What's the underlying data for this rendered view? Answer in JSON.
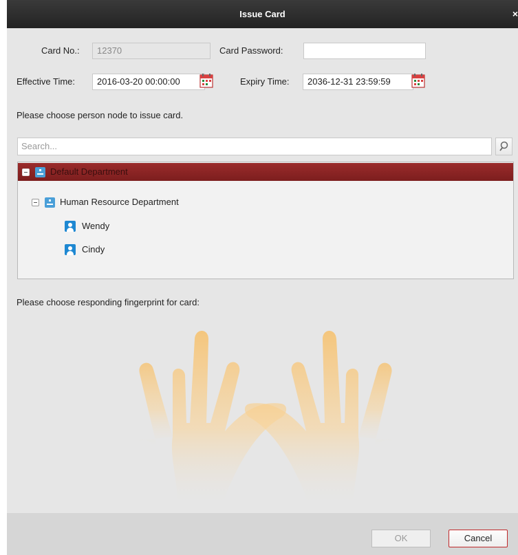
{
  "dialog": {
    "title": "Issue Card",
    "close_glyph": "×"
  },
  "card": {
    "card_no_label": "Card No.:",
    "card_no_value": "12370",
    "password_label": "Card Password:",
    "password_value": "",
    "effective_label": "Effective Time:",
    "effective_value": "2016-03-20 00:00:00",
    "expiry_label": "Expiry Time:",
    "expiry_value": "2036-12-31 23:59:59"
  },
  "instructions": {
    "person_prompt": "Please choose person node to issue card.",
    "fingerprint_prompt": "Please choose responding fingerprint for card:"
  },
  "search": {
    "placeholder": "Search..."
  },
  "tree": {
    "root": {
      "label": "Default Department",
      "selected": true
    },
    "child": {
      "label": "Human Resource Department"
    },
    "persons": [
      {
        "label": "Wendy"
      },
      {
        "label": "Cindy"
      }
    ]
  },
  "buttons": {
    "ok": "OK",
    "cancel": "Cancel"
  },
  "colors": {
    "title_bar": "#2b2b2b",
    "selection": "#8b2424",
    "accent_blue": "#1e88d2",
    "hand": "#f7c06a",
    "cancel_border": "#c0282a"
  },
  "icons": [
    "close-icon",
    "calendar-icon",
    "search-icon",
    "collapse-icon",
    "department-icon",
    "person-icon",
    "left-hand-icon",
    "right-hand-icon"
  ]
}
